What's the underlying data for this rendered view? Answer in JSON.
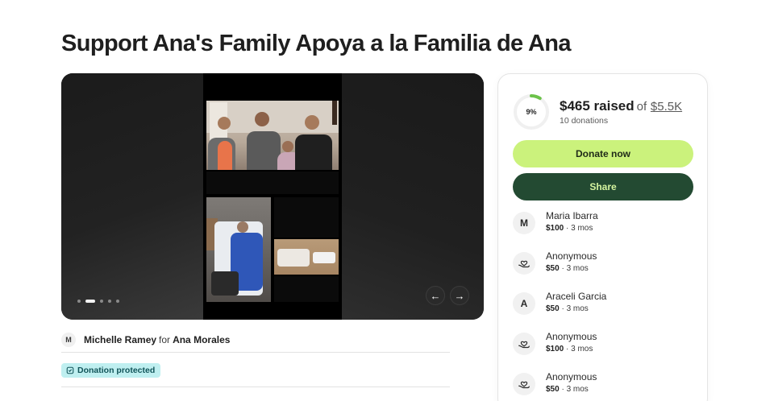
{
  "page": {
    "title": "Support Ana's Family Apoya a la Familia de Ana"
  },
  "carousel": {
    "total_slides": 5,
    "active_slide": 2,
    "prev_icon": "arrow-left-icon",
    "next_icon": "arrow-right-icon",
    "prev_glyph": "←",
    "next_glyph": "→"
  },
  "organizer": {
    "avatar_initial": "M",
    "name": "Michelle Ramey",
    "for_text": "for",
    "beneficiary": "Ana Morales"
  },
  "badge": {
    "label": "Donation protected",
    "icon": "shield-icon"
  },
  "fundraiser": {
    "percent_label": "9%",
    "percent_value": 0.09,
    "raised": "$465 raised",
    "of_text": "of",
    "goal": "$5.5K",
    "donations_count": "10 donations",
    "ring_color": "#6cc24a",
    "ring_track_color": "#f0f0f0"
  },
  "actions": {
    "donate_label": "Donate now",
    "share_label": "Share",
    "donate_color": "#cbf27c",
    "share_color": "#234a32"
  },
  "donors": [
    {
      "avatar": "M",
      "avatar_type": "initial",
      "name": "Maria Ibarra",
      "amount": "$100",
      "time": " · 3 mos"
    },
    {
      "avatar": "heart-hand-icon",
      "avatar_type": "icon",
      "name": "Anonymous",
      "amount": "$50",
      "time": " · 3 mos"
    },
    {
      "avatar": "A",
      "avatar_type": "initial",
      "name": "Araceli Garcia",
      "amount": "$50",
      "time": " · 3 mos"
    },
    {
      "avatar": "heart-hand-icon",
      "avatar_type": "icon",
      "name": "Anonymous",
      "amount": "$100",
      "time": " · 3 mos"
    },
    {
      "avatar": "heart-hand-icon",
      "avatar_type": "icon",
      "name": "Anonymous",
      "amount": "$50",
      "time": " · 3 mos"
    }
  ]
}
